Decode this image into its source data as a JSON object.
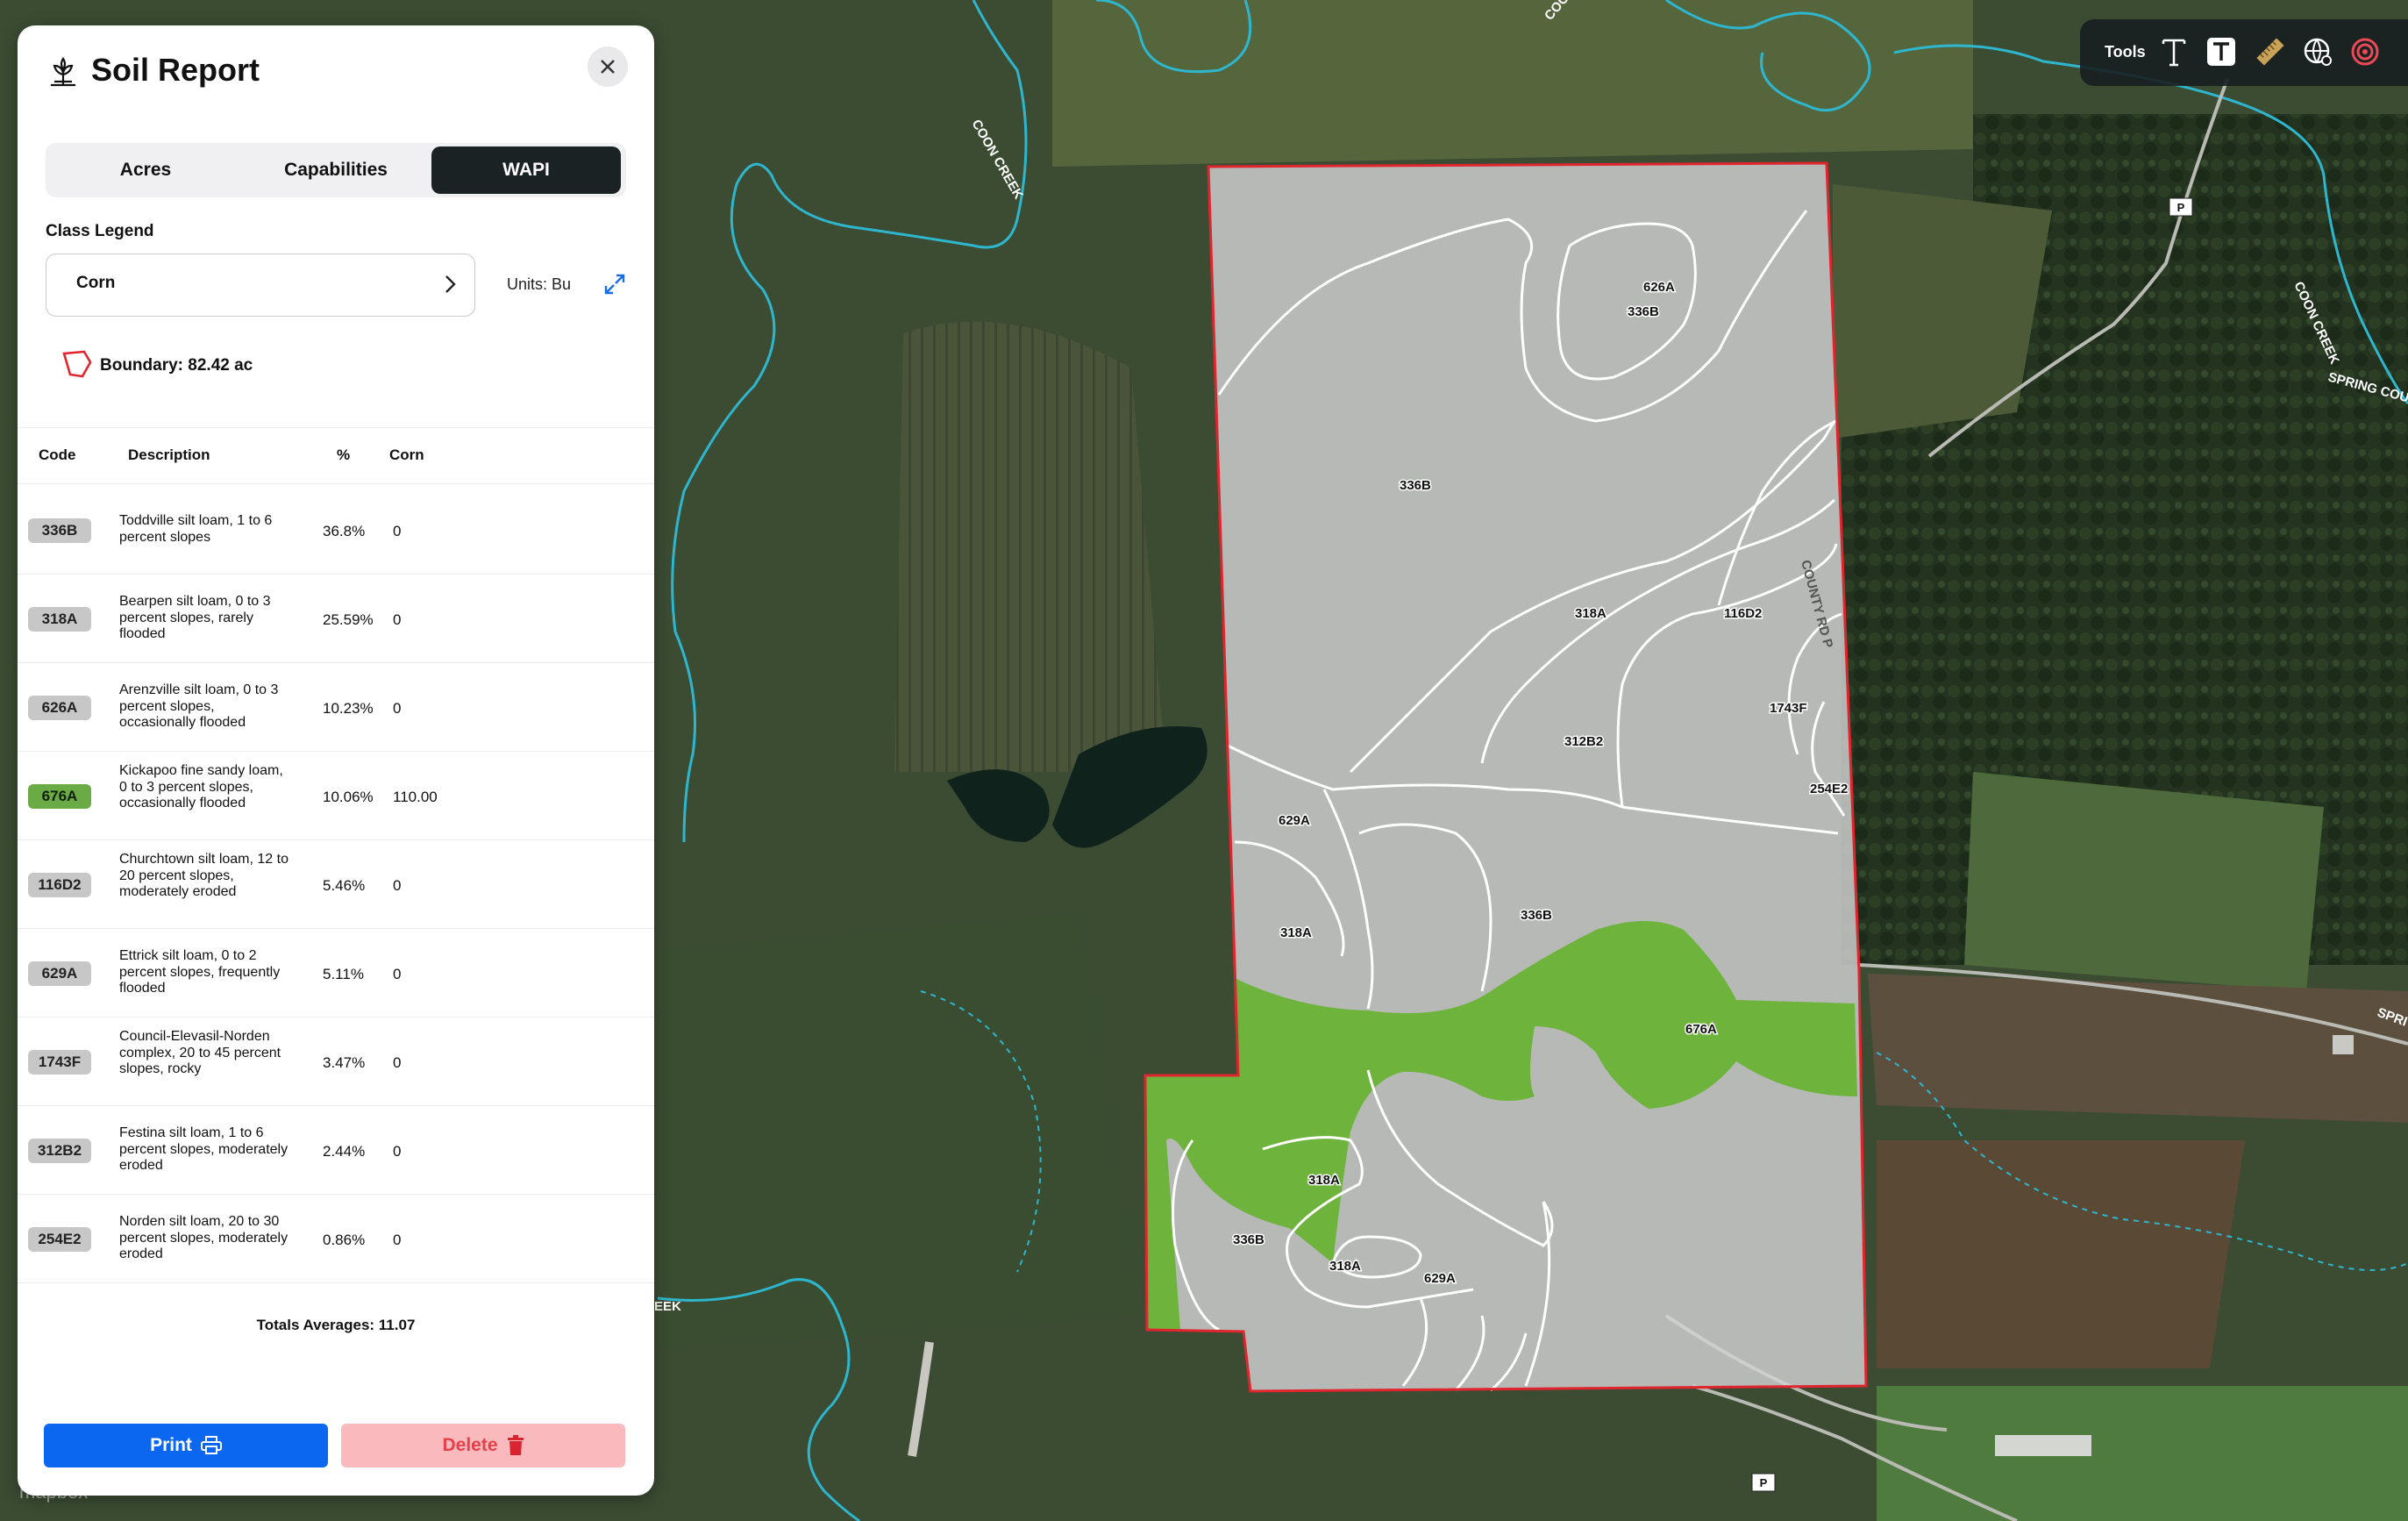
{
  "panel": {
    "title": "Soil Report",
    "tabs": [
      {
        "label": "Acres",
        "active": false
      },
      {
        "label": "Capabilities",
        "active": false
      },
      {
        "label": "WAPI",
        "active": true
      }
    ],
    "class_legend_label": "Class Legend",
    "crop_select_value": "Corn",
    "units_label": "Units: Bu",
    "boundary_label": "Boundary: 82.42 ac",
    "columns": {
      "code": "Code",
      "description": "Description",
      "pct": "%",
      "crop": "Corn"
    },
    "rows": [
      {
        "code": "336B",
        "description": "Toddville silt loam, 1 to 6 percent slopes",
        "pct": "36.8%",
        "value": "0",
        "highlight": false
      },
      {
        "code": "318A",
        "description": "Bearpen silt loam, 0 to 3 percent slopes, rarely flooded",
        "pct": "25.59%",
        "value": "0",
        "highlight": false
      },
      {
        "code": "626A",
        "description": "Arenzville silt loam, 0 to 3 percent slopes, occasionally flooded",
        "pct": "10.23%",
        "value": "0",
        "highlight": false
      },
      {
        "code": "676A",
        "description": "Kickapoo fine sandy loam, 0 to 3 percent slopes, occasionally flooded",
        "pct": "10.06%",
        "value": "110.00",
        "highlight": true
      },
      {
        "code": "116D2",
        "description": "Churchtown silt loam, 12 to 20 percent slopes, moderately eroded",
        "pct": "5.46%",
        "value": "0",
        "highlight": false
      },
      {
        "code": "629A",
        "description": "Ettrick silt loam, 0 to 2 percent slopes, frequently flooded",
        "pct": "5.11%",
        "value": "0",
        "highlight": false
      },
      {
        "code": "1743F",
        "description": "Council-Elevasil-Norden complex, 20 to 45 percent slopes, rocky",
        "pct": "3.47%",
        "value": "0",
        "highlight": false
      },
      {
        "code": "312B2",
        "description": "Festina silt loam, 1 to 6 percent slopes, moderately eroded",
        "pct": "2.44%",
        "value": "0",
        "highlight": false
      },
      {
        "code": "254E2",
        "description": "Norden silt loam, 20 to 30 percent slopes, moderately eroded",
        "pct": "0.86%",
        "value": "0",
        "highlight": false
      }
    ],
    "totals": "Totals Averages: 11.07",
    "print_label": "Print",
    "delete_label": "Delete"
  },
  "toolbar": {
    "label": "Tools",
    "tools": [
      "text-tool-icon",
      "text-box-tool-icon",
      "ruler-tool-icon",
      "globe-tool-icon",
      "target-tool-icon"
    ]
  },
  "map": {
    "street_labels": {
      "coon_creek": "COON CREEK",
      "coon_top": "COO",
      "spring_coulee": "SPRING COU",
      "spring_right": "SPRI",
      "eek": "EEK",
      "county_rd": "COUNTY RD P",
      "route_marker": "P"
    },
    "soil_labels": [
      "626A",
      "336B",
      "336B",
      "318A",
      "116D2",
      "1743F",
      "312B2",
      "254E2",
      "629A",
      "318A",
      "336B",
      "676A",
      "318A",
      "336B",
      "318A",
      "629A"
    ],
    "attribution": "mapbox",
    "colors": {
      "boundary": "#e0252f",
      "highlight_zone": "#66b22e",
      "soil_overlay": "#cfcfcf",
      "water": "#2fb6cf"
    }
  }
}
